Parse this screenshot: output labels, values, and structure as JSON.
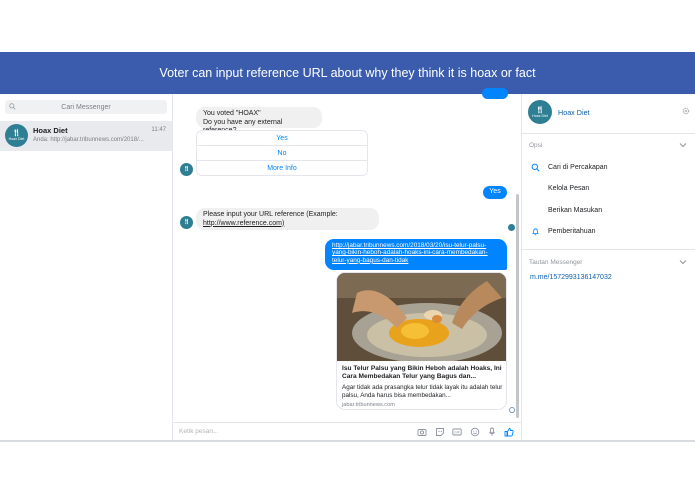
{
  "banner": {
    "caption": "Voter can input reference URL about why they think it is hoax or fact"
  },
  "sidebar": {
    "search_placeholder": "Cari Messenger",
    "conversations": [
      {
        "name": "Hoax Diet",
        "time": "11:47",
        "preview": "Anda: http://jabar.tribunnews.com/2018/...",
        "avatar_text": "Hoax Diet"
      }
    ]
  },
  "chat": {
    "bot_message_1": {
      "line1": "You voted \"HOAX\"",
      "line2": "Do you have any external reference?"
    },
    "quick_replies": [
      "Yes",
      "No",
      "More Info"
    ],
    "user_reply": "Yes",
    "bot_message_2": {
      "line1": "Please input your URL reference (Example:",
      "line2": "http://www.reference.com)"
    },
    "user_link": "http://jabar.tribunnews.com/2018/03/20/isu-telur-palsu-yang-bikin-heboh-adalah-hoaks-ini-cara-membedakan-telur-yang-bagus-dan-tidak",
    "link_preview": {
      "title": "Isu Telur Palsu yang Bikin Heboh adalah Hoaks, Ini Cara Membedakan Telur yang Bagus dan...",
      "description": "Agar tidak ada prasangka telur tidak layak itu adalah telur palsu, Anda harus bisa membedakan...",
      "source": "jabar.tribunnews.com"
    },
    "composer_placeholder": "Ketik pesan..."
  },
  "details": {
    "name": "Hoax Diet",
    "options_title": "Opsi",
    "options": [
      "Cari di Percakapan",
      "Kelola Pesan",
      "Berikan Masukan",
      "Pemberitahuan"
    ],
    "link_section_title": "Tautan Messenger",
    "messenger_link": "m.me/1572993136147032"
  },
  "colors": {
    "banner": "#3b5cad",
    "accent": "#0084ff",
    "avatar": "#2f7f94"
  }
}
